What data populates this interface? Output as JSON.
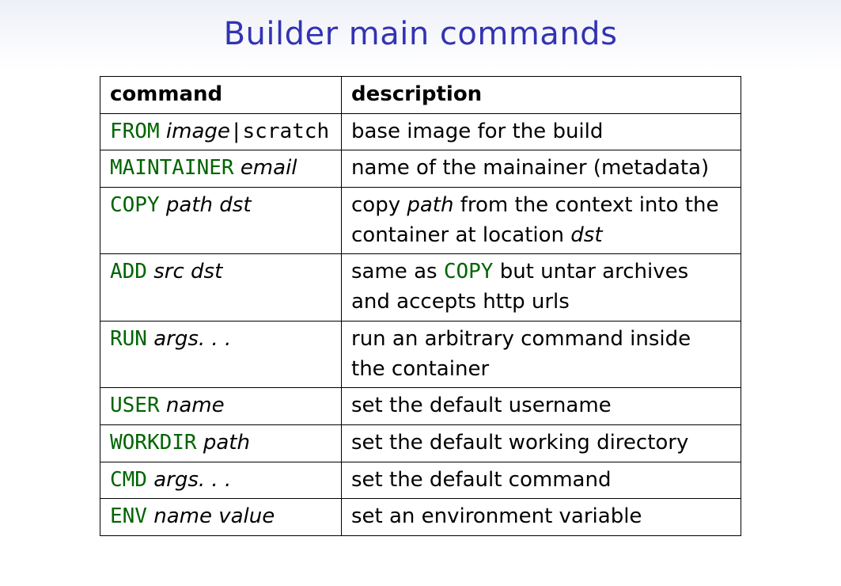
{
  "title": "Builder main commands",
  "headers": {
    "command": "command",
    "description": "description"
  },
  "rows": [
    {
      "cmd": {
        "kw": "FROM",
        "args": "image",
        "extra_plain": "|scratch"
      },
      "desc": {
        "plain": "base image for the build"
      }
    },
    {
      "cmd": {
        "kw": "MAINTAINER",
        "args": "email"
      },
      "desc": {
        "plain": "name of the mainainer (metadata)"
      }
    },
    {
      "cmd": {
        "kw": "COPY",
        "args": "path dst"
      },
      "desc": {
        "pre": "copy ",
        "ital": "path",
        "mid": " from the context into the container at location ",
        "ital2": "dst"
      }
    },
    {
      "cmd": {
        "kw": "ADD",
        "args": "src dst"
      },
      "desc": {
        "pre": "same as ",
        "code": "COPY",
        "post": " but untar archives and accepts http urls"
      }
    },
    {
      "cmd": {
        "kw": "RUN",
        "args": "args. . ."
      },
      "desc": {
        "plain": "run an arbitrary command inside the container"
      }
    },
    {
      "cmd": {
        "kw": "USER",
        "args": "name"
      },
      "desc": {
        "plain": "set the default username"
      }
    },
    {
      "cmd": {
        "kw": "WORKDIR",
        "args": "path"
      },
      "desc": {
        "plain": "set the default working directory"
      }
    },
    {
      "cmd": {
        "kw": "CMD",
        "args": "args. . ."
      },
      "desc": {
        "plain": "set the default command"
      }
    },
    {
      "cmd": {
        "kw": "ENV",
        "args": "name value"
      },
      "desc": {
        "plain": "set an environment variable"
      }
    }
  ]
}
